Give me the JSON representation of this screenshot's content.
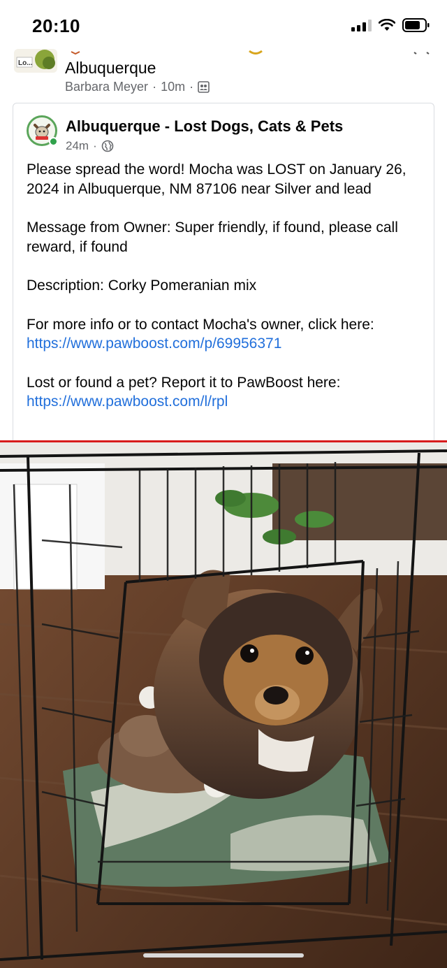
{
  "status_bar": {
    "time": "20:10"
  },
  "group": {
    "thumb_text": "Lo...",
    "name": "Albuquerque",
    "author": "Barbara Meyer",
    "time": "10m",
    "separator": "·"
  },
  "shared_post": {
    "group_name": "Albuquerque - Lost Dogs, Cats & Pets",
    "time": "24m",
    "separator": "·",
    "p1": "Please spread the word! Mocha was LOST on January 26, 2024 in Albuquerque, NM 87106 near Silver and lead",
    "p2": "Message from Owner: Super friendly, if found, please call reward, if found",
    "p3": "Description: Corky Pomeranian mix",
    "p4_text": "For more info or to contact Mocha's owner, click here: ",
    "p4_link": "https://www.pawboost.com/p/69956371",
    "p5_text": "Lost or found a pet? Report it to PawBoost here: ",
    "p5_link": "https://www.pawboost.com/l/rpl"
  },
  "colors": {
    "link": "#216fdb",
    "meta": "#65676b",
    "divider": "#d81c1c",
    "online": "#31a24c"
  },
  "icons": [
    "signal-icon",
    "wifi-icon",
    "battery-icon",
    "globe-icon",
    "group-members-icon"
  ]
}
